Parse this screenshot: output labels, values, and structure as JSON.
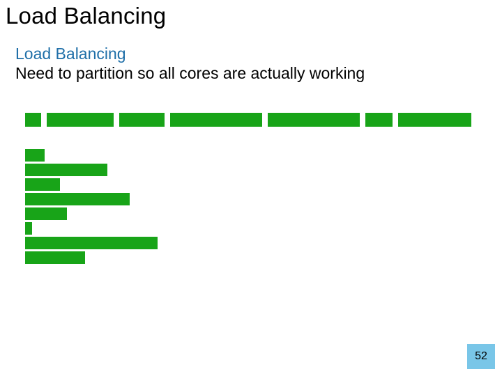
{
  "slide": {
    "title": "Load Balancing",
    "subtitle": "Load Balancing",
    "description": "Need to partition so all cores are actually working",
    "page_number": "52"
  },
  "chart_data": {
    "type": "bar",
    "title": "",
    "xlabel": "",
    "ylabel": "",
    "top_row_widths": [
      24,
      100,
      68,
      138,
      138,
      40,
      110
    ],
    "stack_widths": [
      28,
      118,
      50,
      150,
      60,
      10,
      190,
      86
    ],
    "color": "#18a418"
  }
}
